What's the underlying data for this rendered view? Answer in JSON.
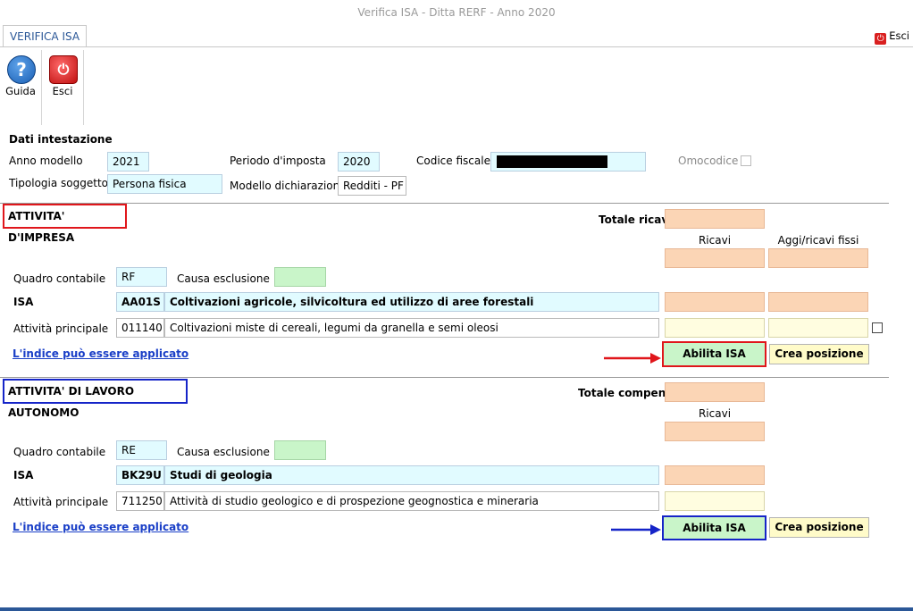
{
  "window": {
    "title": "Verifica ISA - Ditta RERF - Anno 2020"
  },
  "tabs": [
    {
      "label": "VERIFICA ISA"
    }
  ],
  "top_actions": {
    "esci_label": "Esci"
  },
  "ribbon": {
    "guida_label": "Guida",
    "esci_label": "Esci"
  },
  "header": {
    "section_title": "Dati intestazione",
    "anno_modello_label": "Anno modello",
    "anno_modello_value": "2021",
    "periodo_label": "Periodo d'imposta",
    "periodo_value": "2020",
    "codice_fiscale_label": "Codice fiscale",
    "codice_fiscale_value": "",
    "omocodice_label": "Omocodice",
    "tipologia_label": "Tipologia soggetto",
    "tipologia_value": "Persona fisica",
    "modello_label": "Modello dichiarazione",
    "modello_value": "Redditi - PF"
  },
  "impresa": {
    "section_title": "ATTIVITA' D'IMPRESA",
    "totale_label": "Totale ricavi",
    "col_ricavi": "Ricavi",
    "col_aggi": "Aggi/ricavi fissi",
    "quadro_label": "Quadro contabile",
    "quadro_value": "RF",
    "causa_label": "Causa esclusione",
    "isa_label": "ISA",
    "isa_code": "AA01S",
    "isa_desc": "Coltivazioni agricole, silvicoltura ed utilizzo di aree forestali",
    "attivita_label": "Attività principale",
    "attivita_code": "011140",
    "attivita_desc": "Coltivazioni miste di cereali, legumi da granella e semi oleosi",
    "link_text": "L'indice può essere applicato",
    "abilita_label": "Abilita ISA",
    "crea_label": "Crea posizione",
    "highlight_color": "#e0161b"
  },
  "autonomo": {
    "section_title": "ATTIVITA' DI LAVORO AUTONOMO",
    "totale_label": "Totale compensi",
    "col_ricavi": "Ricavi",
    "quadro_label": "Quadro contabile",
    "quadro_value": "RE",
    "causa_label": "Causa esclusione",
    "isa_label": "ISA",
    "isa_code": "BK29U",
    "isa_desc": "Studi di geologia",
    "attivita_label": "Attività principale",
    "attivita_code": "711250",
    "attivita_desc": "Attività di studio geologico e di prospezione geognostica e mineraria",
    "link_text": "L'indice può essere applicato",
    "abilita_label": "Abilita ISA",
    "crea_label": "Crea posizione",
    "highlight_color": "#1524c8"
  }
}
